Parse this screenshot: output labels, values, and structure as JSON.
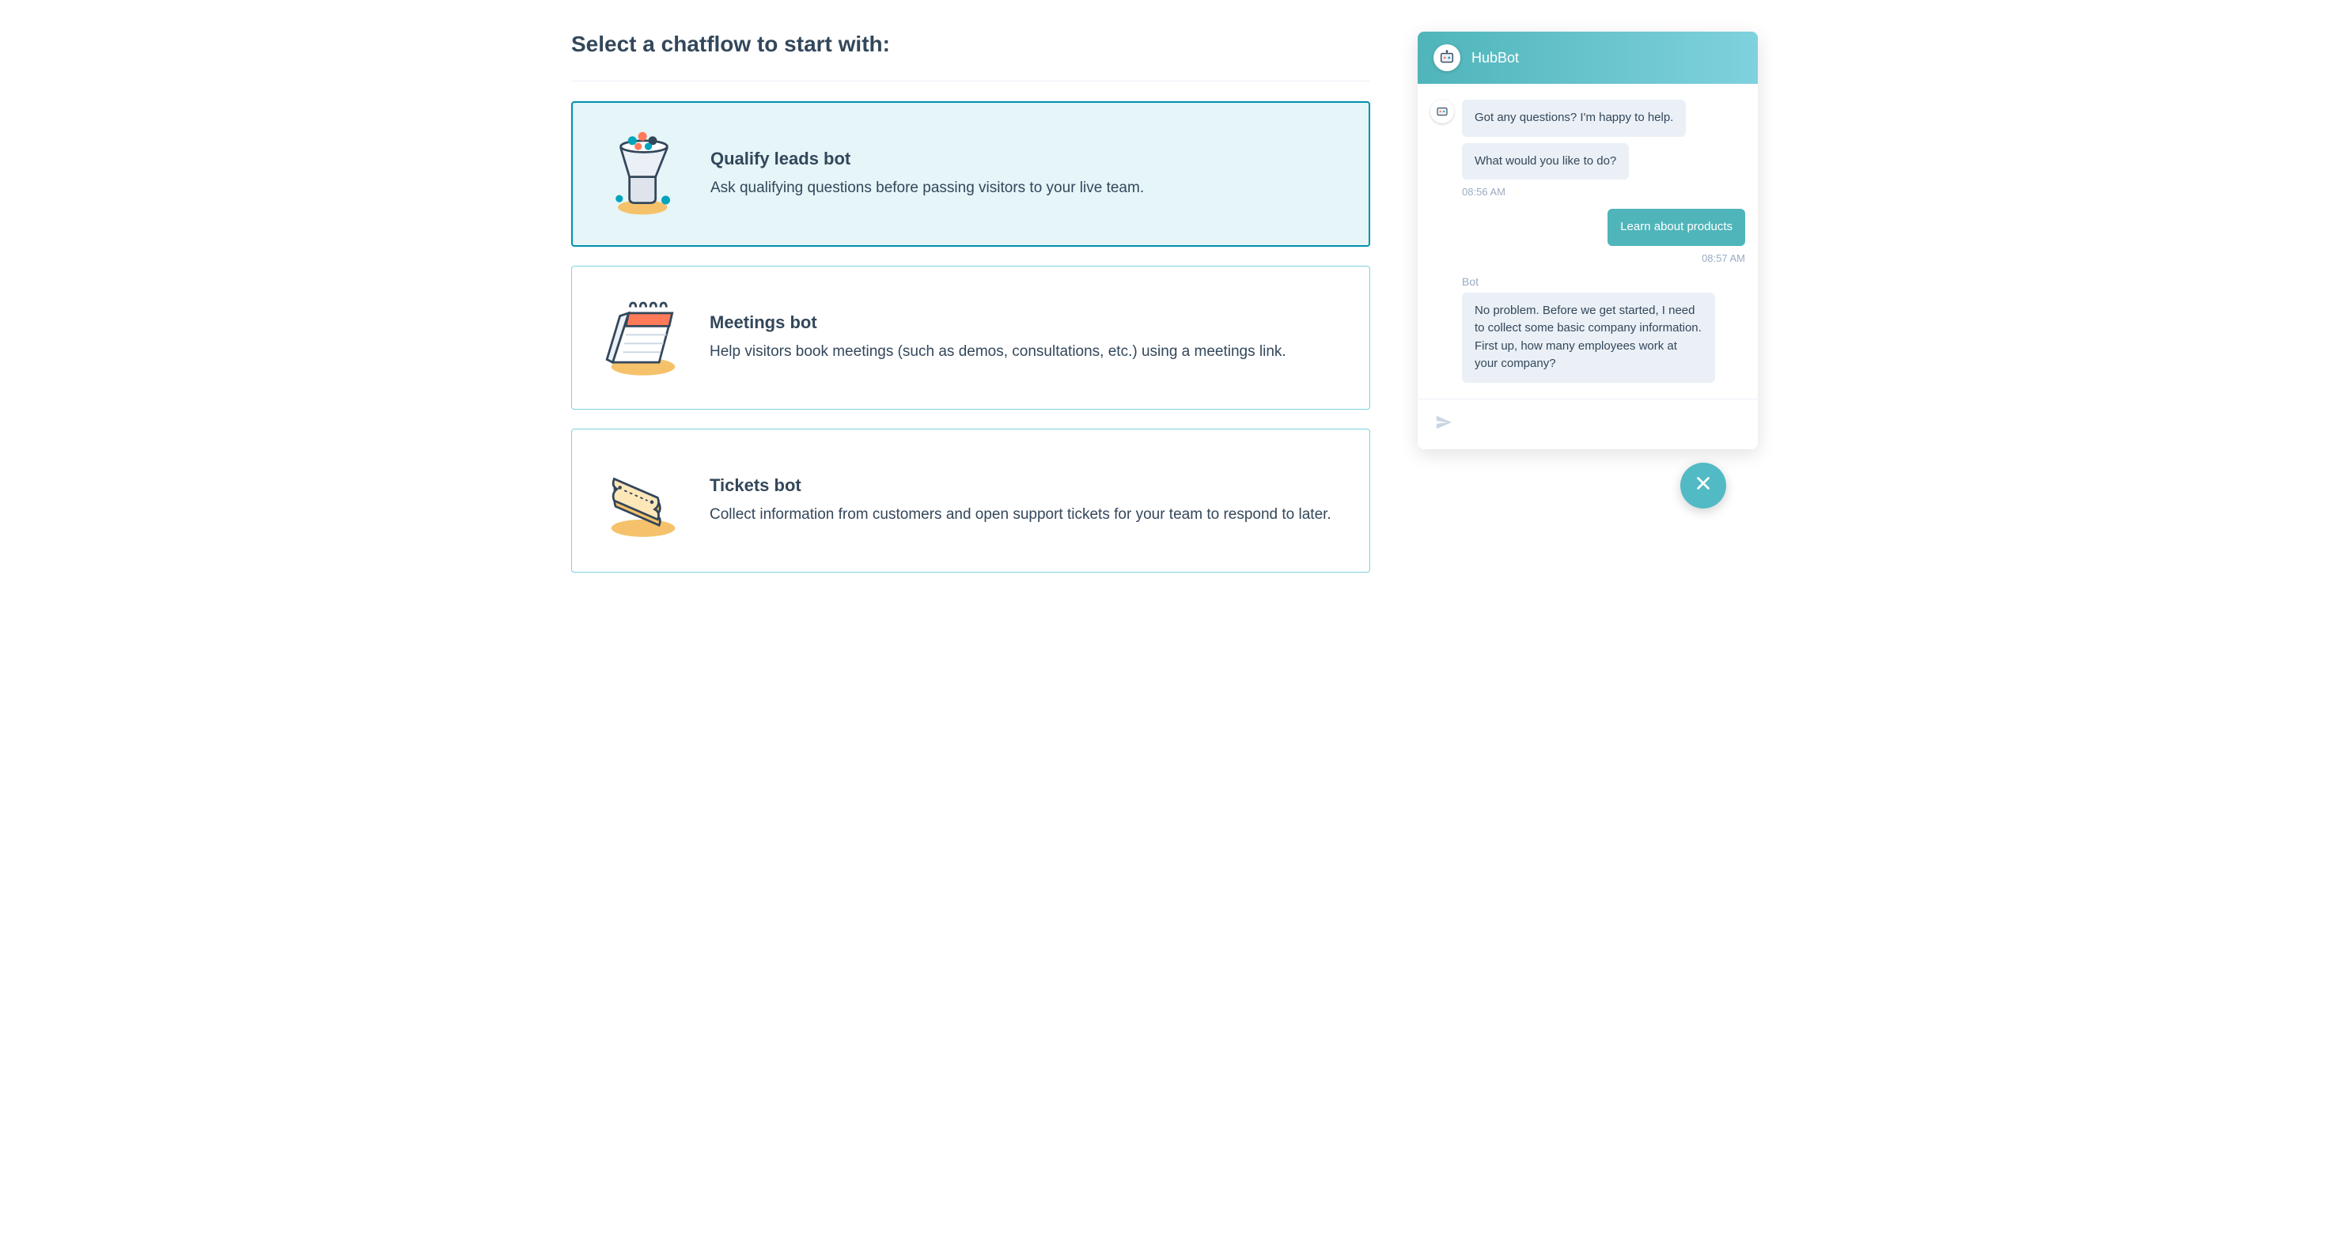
{
  "title": "Select a chatflow to start with:",
  "cards": [
    {
      "title": "Qualify leads bot",
      "description": "Ask qualifying questions before passing visitors to your live team."
    },
    {
      "title": "Meetings bot",
      "description": "Help visitors book meetings (such as demos, consultations, etc.) using a meetings link."
    },
    {
      "title": "Tickets bot",
      "description": "Collect information from customers and open support tickets for your team to respond to later."
    }
  ],
  "chat": {
    "header_title": "HubBot",
    "bot_sender_label": "Bot",
    "messages": {
      "m0": "Got any questions? I'm happy to help.",
      "m1": "What would you like to do?",
      "t0": "08:56 AM",
      "m2": "Learn about products",
      "t1": "08:57 AM",
      "m3": "No problem. Before we get started, I need to collect some basic company information. First up, how many employees work at your company?"
    }
  }
}
